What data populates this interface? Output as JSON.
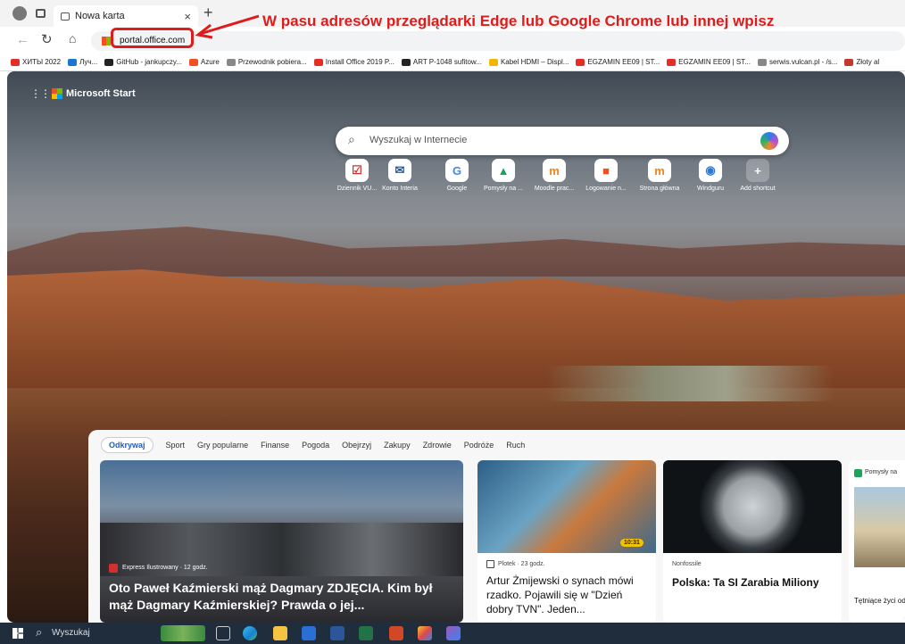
{
  "browser": {
    "tab_title": "Nowa karta",
    "address": "portal.office.com",
    "annotation": "W pasu adresów przeglądarki Edge lub Google Chrome lub innej wpisz",
    "annotation_color": "#e01b1b"
  },
  "bookmarks": [
    {
      "label": "ХИТЫ 2022",
      "color": "#e52d27"
    },
    {
      "label": "Луч...",
      "color": "#1976d2"
    },
    {
      "label": "GitHub - jankupczy...",
      "color": "#222222"
    },
    {
      "label": "Azure",
      "color": "#f25022"
    },
    {
      "label": "Przewodnik pobiera...",
      "color": "#888888"
    },
    {
      "label": "Install Office 2019 P...",
      "color": "#e52d27"
    },
    {
      "label": "ART P-1048 sufitow...",
      "color": "#222222"
    },
    {
      "label": "Kabel HDMI – Displ...",
      "color": "#f2b600"
    },
    {
      "label": "EGZAMIN EE09 | ST...",
      "color": "#e52d27"
    },
    {
      "label": "EGZAMIN EE09 | ST...",
      "color": "#e52d27"
    },
    {
      "label": "serwis.vulcan.pl - /s...",
      "color": "#888888"
    },
    {
      "label": "Złoty al",
      "color": "#c0392b"
    }
  ],
  "start": {
    "brand": "Microsoft Start",
    "search_placeholder": "Wyszukaj w Internecie",
    "shortcuts": [
      {
        "label": "Dziennik VU...",
        "glyph": "☑",
        "color": "#d32f2f"
      },
      {
        "label": "Konto Interia",
        "glyph": "✉",
        "color": "#1e5aa8"
      },
      {
        "label": "Google",
        "glyph": "G",
        "color": "#4285f4"
      },
      {
        "label": "Pomysły na ...",
        "glyph": "▲",
        "color": "#1aa35b"
      },
      {
        "label": "Moodle prac...",
        "glyph": "m",
        "color": "#f98012"
      },
      {
        "label": "Logowanie n...",
        "glyph": "■",
        "color": "#f25022"
      },
      {
        "label": "Strona główna",
        "glyph": "m",
        "color": "#f98012"
      },
      {
        "label": "Windguru",
        "glyph": "◉",
        "color": "#2a7ad5"
      },
      {
        "label": "Add shortcut",
        "glyph": "+",
        "color": "#ffffff"
      }
    ]
  },
  "feed": {
    "tabs": [
      "Odkrywaj",
      "Sport",
      "Gry popularne",
      "Finanse",
      "Pogoda",
      "Obejrzyj",
      "Zakupy",
      "Zdrowie",
      "Podróże",
      "Ruch"
    ],
    "cards": [
      {
        "source": "Express Ilustrowany · 12 godz.",
        "title": "Oto Paweł Kaźmierski mąż Dagmary ZDJĘCIA. Kim był mąż Dagmary Kaźmierskiej? Prawda o jej..."
      },
      {
        "source": "Plotek · 23 godz.",
        "title": "Artur Żmijewski o synach mówi rzadko. Pojawili się w \"Dzień dobry TVN\". Jeden...",
        "badge": "10:31"
      },
      {
        "source": "Nonfossile",
        "title": "Polska: Ta SI Zarabia Miliony"
      },
      {
        "source": "Pomysły na",
        "title": "Tętniące życi odwiedzić —"
      }
    ]
  },
  "taskbar": {
    "search_label": "Wyszukaj"
  }
}
